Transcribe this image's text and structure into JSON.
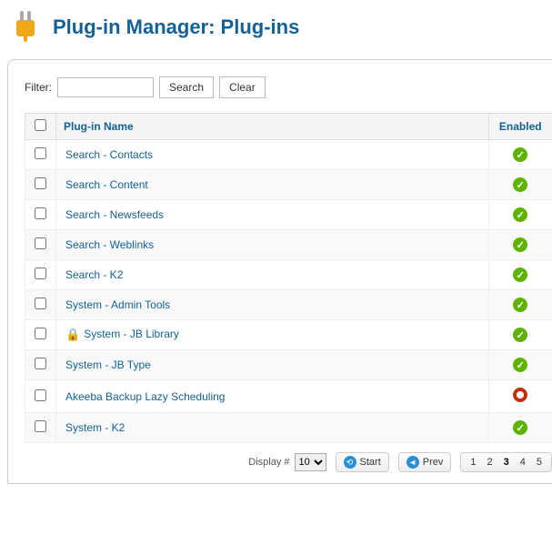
{
  "header": {
    "title": "Plug-in Manager: Plug-ins"
  },
  "filter": {
    "label": "Filter:",
    "value": "",
    "search_label": "Search",
    "clear_label": "Clear"
  },
  "columns": {
    "name": "Plug-in Name",
    "enabled": "Enabled"
  },
  "plugins": [
    {
      "name": "Search - Contacts",
      "enabled": true,
      "locked": false
    },
    {
      "name": "Search - Content",
      "enabled": true,
      "locked": false
    },
    {
      "name": "Search - Newsfeeds",
      "enabled": true,
      "locked": false
    },
    {
      "name": "Search - Weblinks",
      "enabled": true,
      "locked": false
    },
    {
      "name": "Search - K2",
      "enabled": true,
      "locked": false
    },
    {
      "name": "System - Admin Tools",
      "enabled": true,
      "locked": false
    },
    {
      "name": "System - JB Library",
      "enabled": true,
      "locked": true
    },
    {
      "name": "System - JB Type",
      "enabled": true,
      "locked": false
    },
    {
      "name": "Akeeba Backup Lazy Scheduling",
      "enabled": false,
      "locked": false
    },
    {
      "name": "System - K2",
      "enabled": true,
      "locked": false
    }
  ],
  "pagination": {
    "display_label": "Display #",
    "display_value": "10",
    "start_label": "Start",
    "prev_label": "Prev",
    "pages": [
      "1",
      "2",
      "3",
      "4",
      "5"
    ],
    "current_page": "3"
  }
}
